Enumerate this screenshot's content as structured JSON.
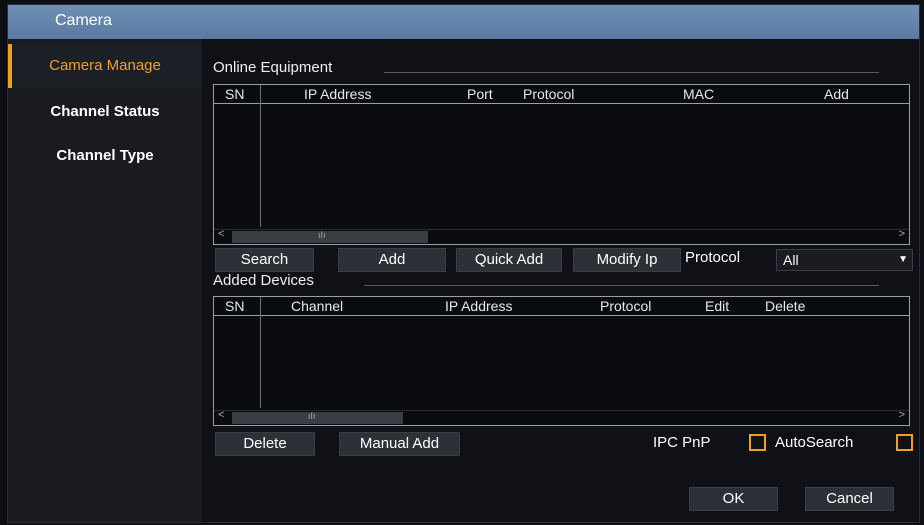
{
  "window": {
    "title": "Camera"
  },
  "sidebar": {
    "items": [
      {
        "label": "Camera Manage"
      },
      {
        "label": "Channel Status"
      },
      {
        "label": "Channel Type"
      }
    ]
  },
  "online": {
    "title": "Online Equipment",
    "columns": [
      "SN",
      "IP Address",
      "Port",
      "Protocol",
      "MAC",
      "Add"
    ],
    "rows": []
  },
  "online_buttons": {
    "search": "Search",
    "add": "Add",
    "quick_add": "Quick Add",
    "modify_ip": "Modify Ip"
  },
  "protocol": {
    "label": "Protocol",
    "value": "All"
  },
  "added": {
    "title": "Added Devices",
    "columns": [
      "SN",
      "Channel",
      "IP Address",
      "Protocol",
      "Edit",
      "Delete"
    ],
    "rows": []
  },
  "added_buttons": {
    "delete": "Delete",
    "manual_add": "Manual Add"
  },
  "options": {
    "ipc_pnp": "IPC PnP",
    "auto_search": "AutoSearch",
    "ipc_pnp_checked": false,
    "auto_search_checked": false
  },
  "footer": {
    "ok": "OK",
    "cancel": "Cancel"
  },
  "colors": {
    "accent": "#f0a020",
    "titlebar": "#6e8fb6"
  }
}
